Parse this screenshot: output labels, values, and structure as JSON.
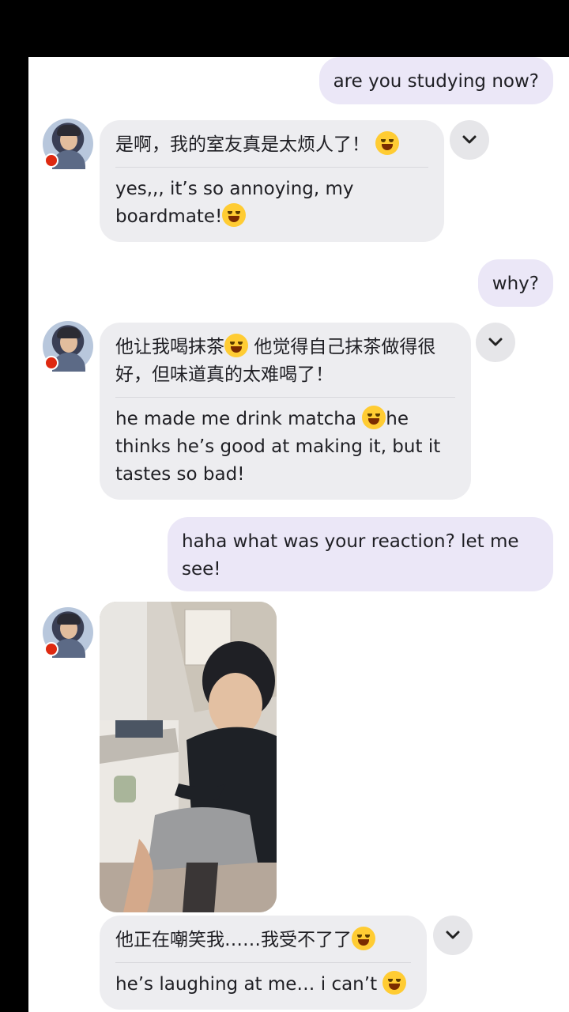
{
  "messages": [
    {
      "text": "are you studying now?"
    },
    {
      "zh": "是啊，我的室友真是太烦人了！",
      "en": "yes,,, it’s so annoying, my boardmate!"
    },
    {
      "text": "why?"
    },
    {
      "zh": "他让我喝抹茶",
      "zh2": "他觉得自己抹茶做得很好，但味道真的太难喝了！",
      "en": "he made me drink matcha",
      "en2": "he thinks he’s good at making it, but it tastes so bad!"
    },
    {
      "text": "haha what was your reaction? let me see!"
    },
    {
      "zh": "他正在嘲笑我……我受不了了",
      "en": "he’s laughing at me… i can’t"
    }
  ],
  "icons": {
    "chevron": "chevron-down-icon",
    "crying_emoji": "loudly-crying-face-emoji",
    "laughing_emoji": "face-with-tears-of-joy-emoji",
    "flag": "china-flag-icon"
  },
  "colors": {
    "sent_bubble": "#ebe7f7",
    "received_bubble": "#ededf0",
    "background": "#ffffff",
    "frame": "#000000"
  }
}
